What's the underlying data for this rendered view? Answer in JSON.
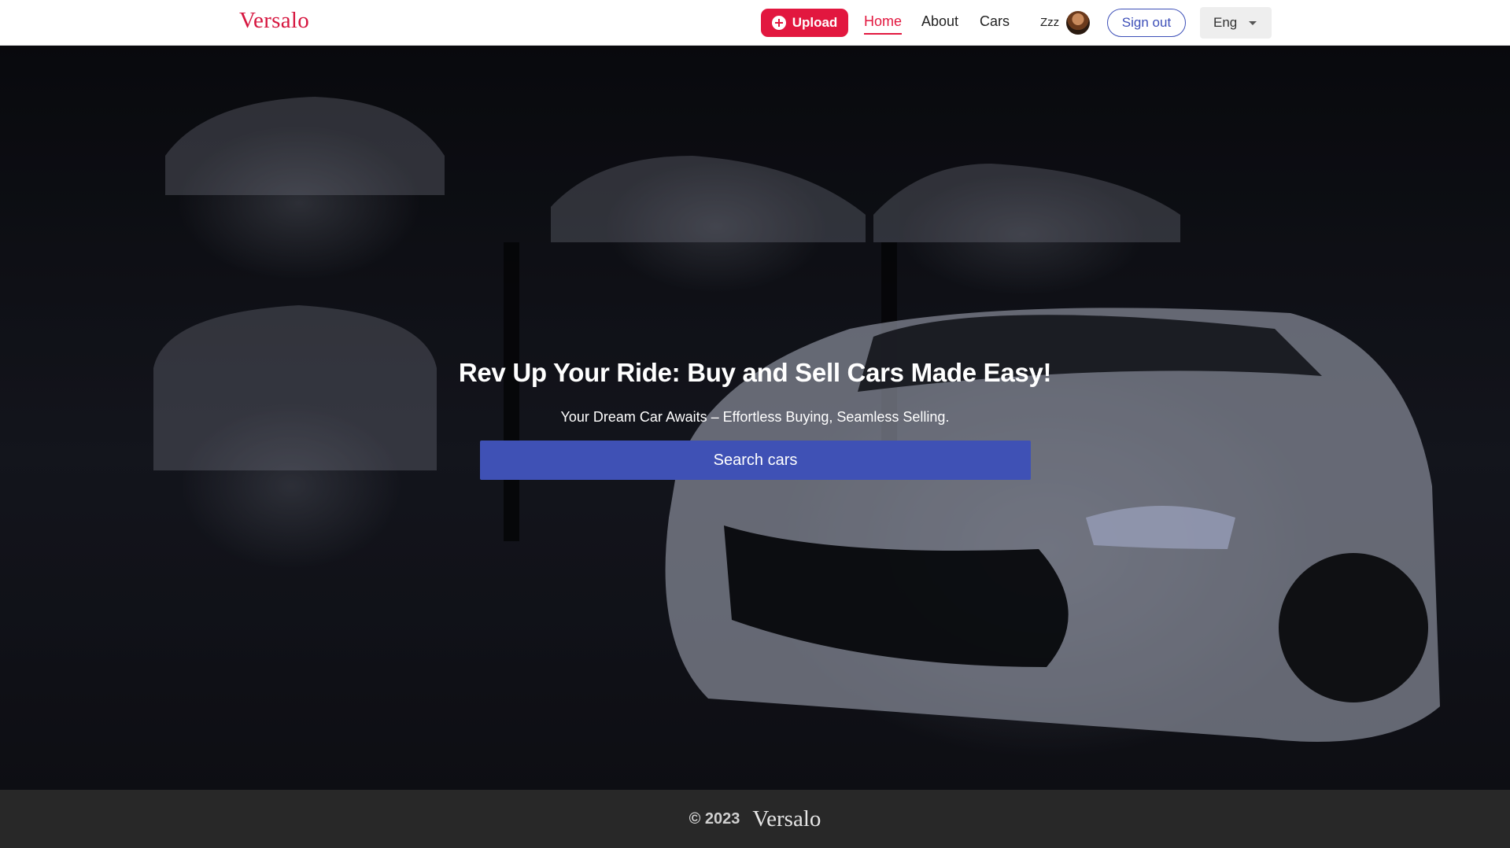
{
  "header": {
    "logo": "Versalo",
    "upload_label": "Upload",
    "nav": {
      "home": "Home",
      "about": "About",
      "cars": "Cars"
    },
    "username": "Zzz",
    "signout_label": "Sign out",
    "language": "Eng"
  },
  "hero": {
    "title": "Rev Up Your Ride: Buy and Sell Cars Made Easy!",
    "subtitle": "Your Dream Car Awaits – Effortless Buying, Seamless Selling.",
    "search_label": "Search cars"
  },
  "footer": {
    "copyright": "© 2023",
    "logo": "Versalo"
  },
  "colors": {
    "brand": "#e2173f",
    "primary_button": "#3f51b5",
    "footer_bg": "#282828"
  },
  "icons": {
    "upload": "plus-circle-icon",
    "language": "caret-down-icon"
  }
}
